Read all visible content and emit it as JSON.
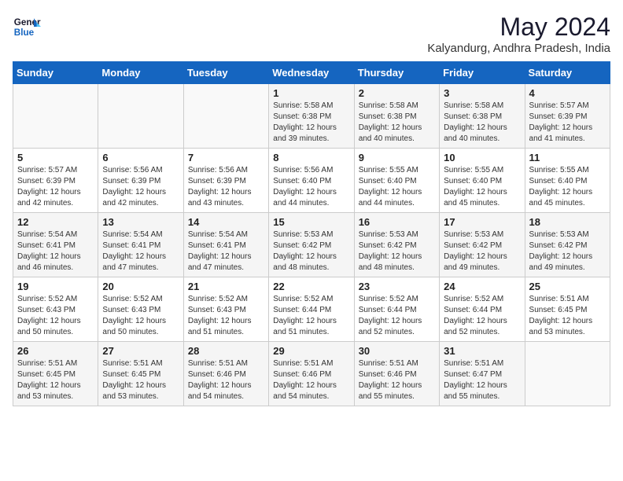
{
  "header": {
    "logo_line1": "General",
    "logo_line2": "Blue",
    "month_year": "May 2024",
    "location": "Kalyandurg, Andhra Pradesh, India"
  },
  "days_of_week": [
    "Sunday",
    "Monday",
    "Tuesday",
    "Wednesday",
    "Thursday",
    "Friday",
    "Saturday"
  ],
  "weeks": [
    [
      {
        "day": "",
        "info": ""
      },
      {
        "day": "",
        "info": ""
      },
      {
        "day": "",
        "info": ""
      },
      {
        "day": "1",
        "info": "Sunrise: 5:58 AM\nSunset: 6:38 PM\nDaylight: 12 hours\nand 39 minutes."
      },
      {
        "day": "2",
        "info": "Sunrise: 5:58 AM\nSunset: 6:38 PM\nDaylight: 12 hours\nand 40 minutes."
      },
      {
        "day": "3",
        "info": "Sunrise: 5:58 AM\nSunset: 6:38 PM\nDaylight: 12 hours\nand 40 minutes."
      },
      {
        "day": "4",
        "info": "Sunrise: 5:57 AM\nSunset: 6:39 PM\nDaylight: 12 hours\nand 41 minutes."
      }
    ],
    [
      {
        "day": "5",
        "info": "Sunrise: 5:57 AM\nSunset: 6:39 PM\nDaylight: 12 hours\nand 42 minutes."
      },
      {
        "day": "6",
        "info": "Sunrise: 5:56 AM\nSunset: 6:39 PM\nDaylight: 12 hours\nand 42 minutes."
      },
      {
        "day": "7",
        "info": "Sunrise: 5:56 AM\nSunset: 6:39 PM\nDaylight: 12 hours\nand 43 minutes."
      },
      {
        "day": "8",
        "info": "Sunrise: 5:56 AM\nSunset: 6:40 PM\nDaylight: 12 hours\nand 44 minutes."
      },
      {
        "day": "9",
        "info": "Sunrise: 5:55 AM\nSunset: 6:40 PM\nDaylight: 12 hours\nand 44 minutes."
      },
      {
        "day": "10",
        "info": "Sunrise: 5:55 AM\nSunset: 6:40 PM\nDaylight: 12 hours\nand 45 minutes."
      },
      {
        "day": "11",
        "info": "Sunrise: 5:55 AM\nSunset: 6:40 PM\nDaylight: 12 hours\nand 45 minutes."
      }
    ],
    [
      {
        "day": "12",
        "info": "Sunrise: 5:54 AM\nSunset: 6:41 PM\nDaylight: 12 hours\nand 46 minutes."
      },
      {
        "day": "13",
        "info": "Sunrise: 5:54 AM\nSunset: 6:41 PM\nDaylight: 12 hours\nand 47 minutes."
      },
      {
        "day": "14",
        "info": "Sunrise: 5:54 AM\nSunset: 6:41 PM\nDaylight: 12 hours\nand 47 minutes."
      },
      {
        "day": "15",
        "info": "Sunrise: 5:53 AM\nSunset: 6:42 PM\nDaylight: 12 hours\nand 48 minutes."
      },
      {
        "day": "16",
        "info": "Sunrise: 5:53 AM\nSunset: 6:42 PM\nDaylight: 12 hours\nand 48 minutes."
      },
      {
        "day": "17",
        "info": "Sunrise: 5:53 AM\nSunset: 6:42 PM\nDaylight: 12 hours\nand 49 minutes."
      },
      {
        "day": "18",
        "info": "Sunrise: 5:53 AM\nSunset: 6:42 PM\nDaylight: 12 hours\nand 49 minutes."
      }
    ],
    [
      {
        "day": "19",
        "info": "Sunrise: 5:52 AM\nSunset: 6:43 PM\nDaylight: 12 hours\nand 50 minutes."
      },
      {
        "day": "20",
        "info": "Sunrise: 5:52 AM\nSunset: 6:43 PM\nDaylight: 12 hours\nand 50 minutes."
      },
      {
        "day": "21",
        "info": "Sunrise: 5:52 AM\nSunset: 6:43 PM\nDaylight: 12 hours\nand 51 minutes."
      },
      {
        "day": "22",
        "info": "Sunrise: 5:52 AM\nSunset: 6:44 PM\nDaylight: 12 hours\nand 51 minutes."
      },
      {
        "day": "23",
        "info": "Sunrise: 5:52 AM\nSunset: 6:44 PM\nDaylight: 12 hours\nand 52 minutes."
      },
      {
        "day": "24",
        "info": "Sunrise: 5:52 AM\nSunset: 6:44 PM\nDaylight: 12 hours\nand 52 minutes."
      },
      {
        "day": "25",
        "info": "Sunrise: 5:51 AM\nSunset: 6:45 PM\nDaylight: 12 hours\nand 53 minutes."
      }
    ],
    [
      {
        "day": "26",
        "info": "Sunrise: 5:51 AM\nSunset: 6:45 PM\nDaylight: 12 hours\nand 53 minutes."
      },
      {
        "day": "27",
        "info": "Sunrise: 5:51 AM\nSunset: 6:45 PM\nDaylight: 12 hours\nand 53 minutes."
      },
      {
        "day": "28",
        "info": "Sunrise: 5:51 AM\nSunset: 6:46 PM\nDaylight: 12 hours\nand 54 minutes."
      },
      {
        "day": "29",
        "info": "Sunrise: 5:51 AM\nSunset: 6:46 PM\nDaylight: 12 hours\nand 54 minutes."
      },
      {
        "day": "30",
        "info": "Sunrise: 5:51 AM\nSunset: 6:46 PM\nDaylight: 12 hours\nand 55 minutes."
      },
      {
        "day": "31",
        "info": "Sunrise: 5:51 AM\nSunset: 6:47 PM\nDaylight: 12 hours\nand 55 minutes."
      },
      {
        "day": "",
        "info": ""
      }
    ]
  ]
}
